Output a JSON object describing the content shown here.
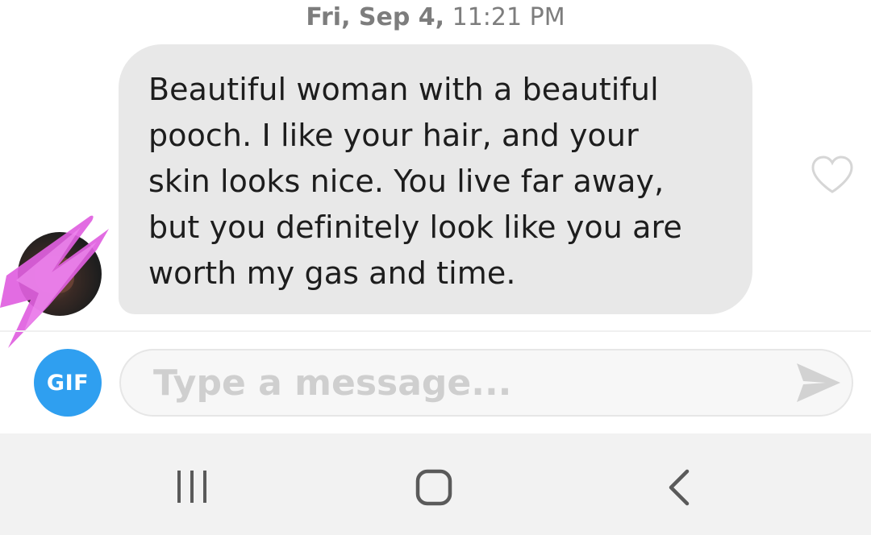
{
  "timestamp": {
    "date": "Fri, Sep 4,",
    "time": "11:21 PM"
  },
  "message": {
    "text": "Beautiful woman with a beautiful\npooch. I like your hair, and your\nskin looks nice. You live far away,\nbut you definitely look like you are\nworth my gas and time."
  },
  "compose": {
    "gif_label": "GIF",
    "placeholder": "Type a message..."
  },
  "colors": {
    "bubble": "#e8e8e8",
    "gif_button": "#2f9ff0",
    "redaction": "#e060e0",
    "navbar": "#f2f2f2"
  },
  "icons": {
    "like": "heart-outline-icon",
    "send": "paper-plane-icon",
    "nav": [
      "recents-icon",
      "home-icon",
      "back-icon"
    ]
  }
}
